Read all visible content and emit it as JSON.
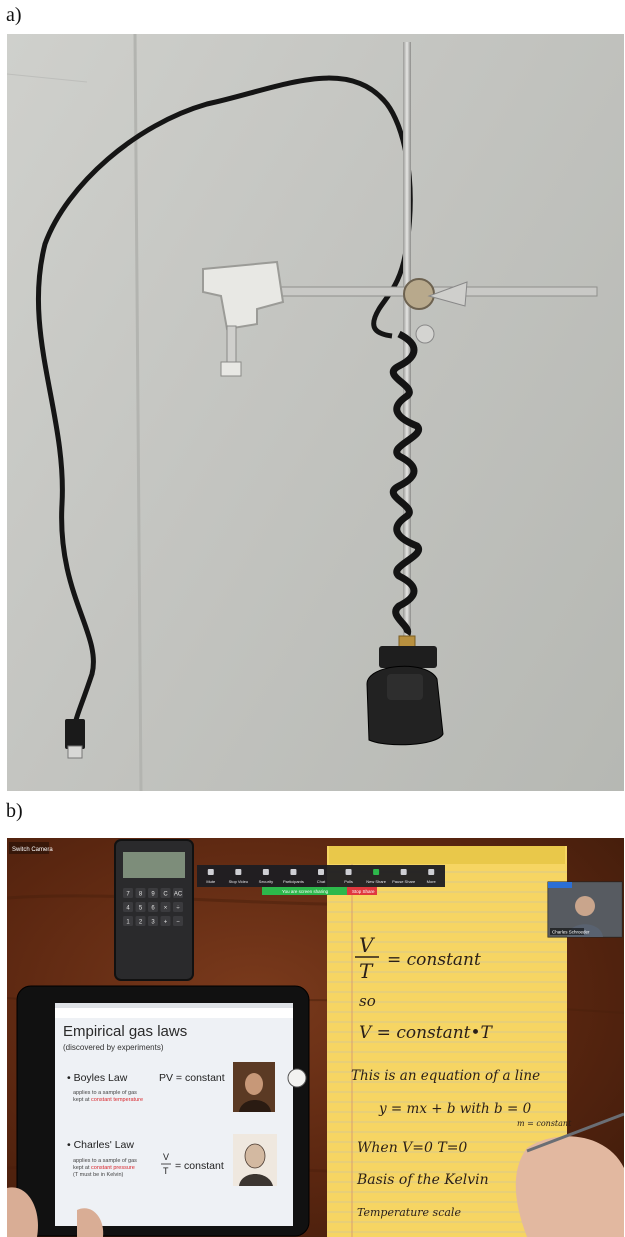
{
  "panels": {
    "a": {
      "label": "a)"
    },
    "b": {
      "label": "b)"
    }
  },
  "zoom": {
    "switch_camera": "Switch Camera",
    "toolbar": [
      "Mute",
      "Stop Video",
      "Security",
      "Participants",
      "Chat",
      "Polls",
      "New Share",
      "Pause Share",
      "More"
    ],
    "share_banner": "You are screen sharing",
    "stop_share": "Stop Share",
    "participant_name": "Charles Schroeder"
  },
  "slide": {
    "title": "Empirical gas laws",
    "subtitle": "(discovered by experiments)",
    "boyle": {
      "name": "• Boyles Law",
      "equation": "PV = constant",
      "note1": "applies to a sample of gas",
      "note2_prefix": "kept at ",
      "note2_highlight": "constant temperature"
    },
    "charles": {
      "name": "• Charles' Law",
      "frac_num": "V",
      "frac_den": "T",
      "equation_rest": "= constant",
      "note1": "applies to a sample of gas",
      "note2_prefix": "kept at ",
      "note2_highlight": "constant pressure",
      "note3": "(T must be in Kelvin)"
    }
  },
  "notepad": {
    "frac_num": "V",
    "frac_den": "T",
    "line1_rest": "= constant",
    "line2": "so",
    "line3": "V = constant•T",
    "line4": "This is an equation of a line",
    "line5": "y = mx + b      with  b = 0",
    "line5b": "m = constant",
    "line6": "When  V=0  T=0",
    "line7": "Basis of the Kelvin",
    "line8": "Temperature scale"
  },
  "calculator": {
    "keys": [
      "7",
      "8",
      "9",
      "C",
      "AC",
      "4",
      "5",
      "6",
      "×",
      "÷",
      "1",
      "2",
      "3",
      "+",
      "−"
    ]
  },
  "colors": {
    "slide_highlight": "#d9262c",
    "zoom_green": "#2db84b",
    "zoom_red": "#e0383e",
    "notepad_yellow": "#f6d563"
  }
}
